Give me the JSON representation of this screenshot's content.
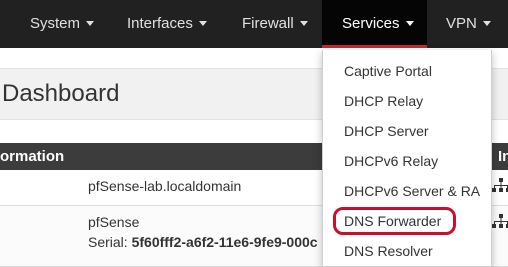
{
  "navbar": {
    "items": [
      {
        "label": "System"
      },
      {
        "label": "Interfaces"
      },
      {
        "label": "Firewall"
      },
      {
        "label": "Services",
        "active": true
      },
      {
        "label": "VPN"
      }
    ]
  },
  "page": {
    "title": "Dashboard"
  },
  "panel": {
    "heading": "ormation",
    "heading_right": "In",
    "rows": [
      {
        "line1": "pfSense-lab.localdomain"
      },
      {
        "line1": "pfSense",
        "serial_label": "Serial: ",
        "serial_value": "5f60fff2-a6f2-11e6-9fe9-000c"
      }
    ]
  },
  "services_menu": {
    "items": [
      {
        "label": "Captive Portal"
      },
      {
        "label": "DHCP Relay"
      },
      {
        "label": "DHCP Server"
      },
      {
        "label": "DHCPv6 Relay"
      },
      {
        "label": "DHCPv6 Server & RA"
      },
      {
        "label": "DNS Forwarder",
        "highlighted": true
      },
      {
        "label": "DNS Resolver"
      }
    ]
  },
  "colors": {
    "navbar_bg": "#212121",
    "active_bar": "#c62828",
    "highlight_ring": "#c8102e",
    "panel_heading_bg": "#3c3c3c"
  },
  "icons": {
    "network_icon": "network-icon",
    "caret_icon": "caret-down-icon"
  }
}
